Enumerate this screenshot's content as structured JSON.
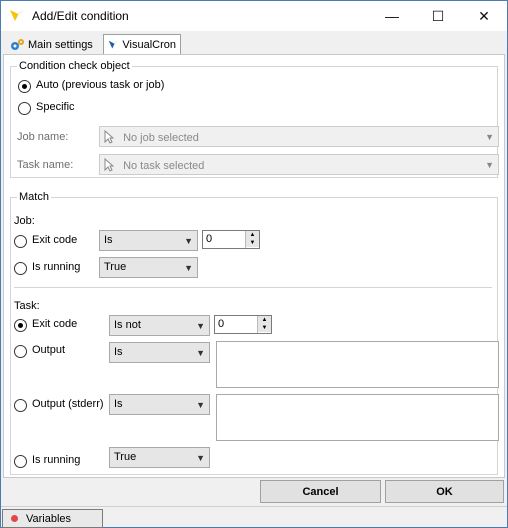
{
  "window": {
    "title": "Add/Edit condition",
    "controls": {
      "minimize": "—",
      "maximize": "☐",
      "close": "✕"
    }
  },
  "tabs": [
    {
      "label": "Main settings",
      "icon": "gears-icon",
      "active": false
    },
    {
      "label": "VisualCron",
      "icon": "visualcron-logo-icon",
      "active": true
    }
  ],
  "condition_check": {
    "legend": "Condition check object",
    "options": [
      {
        "label": "Auto (previous task or job)",
        "checked": true
      },
      {
        "label": "Specific",
        "checked": false
      }
    ],
    "job_name_label": "Job name:",
    "job_name_value": "No job selected",
    "task_name_label": "Task name:",
    "task_name_value": "No task selected"
  },
  "match": {
    "legend": "Match",
    "job": {
      "heading": "Job:",
      "exit_code_label": "Exit code",
      "exit_code_operator": "Is",
      "exit_code_value": "0",
      "is_running_label": "Is running",
      "is_running_value": "True"
    },
    "task": {
      "heading": "Task:",
      "exit_code_label": "Exit code",
      "exit_code_operator": "Is not",
      "exit_code_value": "0",
      "output_label": "Output",
      "output_operator": "Is",
      "output_stderr_label": "Output (stderr)",
      "output_stderr_operator": "Is",
      "is_running_label": "Is running",
      "is_running_value": "True"
    }
  },
  "buttons": {
    "cancel": "Cancel",
    "ok": "OK"
  },
  "statusbar": {
    "variables_label": "Variables",
    "variables_dot_color": "#e04848"
  },
  "colors": {
    "accent": "#4a7bb5",
    "logo_yellow": "#f5c400",
    "logo_blue": "#1f5fa8"
  }
}
